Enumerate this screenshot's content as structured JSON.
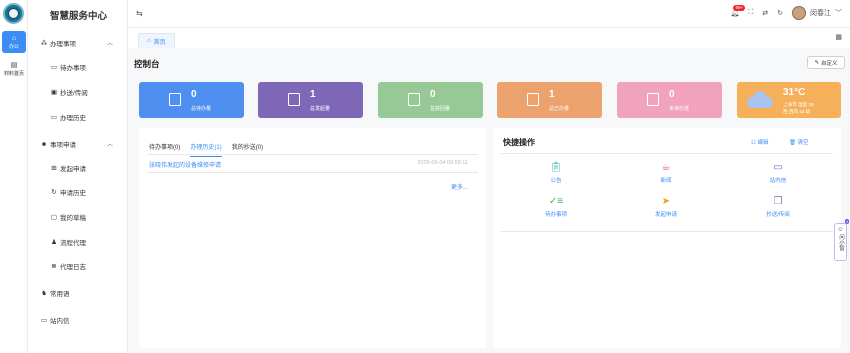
{
  "app_title": "智慧服务中心",
  "rail": [
    {
      "label": "办公",
      "icon": "home-icon",
      "active": true
    },
    {
      "label": "材料首页",
      "icon": "calendar-icon",
      "active": false
    }
  ],
  "sidebar": {
    "groups": [
      {
        "label": "办理事项",
        "icon": "apps-icon",
        "items": [
          {
            "label": "待办事项",
            "icon": "briefcase-icon"
          },
          {
            "label": "抄送/传阅",
            "icon": "inbox-icon"
          },
          {
            "label": "办理历史",
            "icon": "history-icon"
          }
        ]
      },
      {
        "label": "事项申请",
        "icon": "form-icon",
        "items": [
          {
            "label": "发起申请",
            "icon": "plus-square-icon"
          },
          {
            "label": "申请历史",
            "icon": "refresh-icon"
          },
          {
            "label": "我的草稿",
            "icon": "draft-icon"
          },
          {
            "label": "流程代理",
            "icon": "agent-icon"
          },
          {
            "label": "代理日志",
            "icon": "log-icon"
          }
        ]
      }
    ],
    "extra": [
      {
        "label": "常用语",
        "icon": "users-icon"
      },
      {
        "label": "站内信",
        "icon": "message-icon"
      }
    ]
  },
  "topbar": {
    "notification_badge": "99+",
    "username": "闵春江"
  },
  "tabs": [
    {
      "label": "首页"
    }
  ],
  "console": {
    "title": "控制台",
    "customize_label": "自定义",
    "stats": [
      {
        "value": "0",
        "label": "总待办量",
        "color": "#4f8ff0"
      },
      {
        "value": "1",
        "label": "总发起量",
        "color": "#7e67b7"
      },
      {
        "value": "0",
        "label": "总获回量",
        "color": "#97c996"
      },
      {
        "value": "1",
        "label": "总已办量",
        "color": "#eca26c"
      },
      {
        "value": "0",
        "label": "未读抄送",
        "color": "#f1a2bd"
      }
    ],
    "weather": {
      "temp": "31°C",
      "line1": "上海市  湿度 39",
      "line2": "西 西风 ≤3 级",
      "color": "#f7b05a"
    }
  },
  "left_panel": {
    "tabs": [
      {
        "label": "待办事项(0)",
        "active": false
      },
      {
        "label": "办理历史(1)",
        "active": true
      },
      {
        "label": "我的抄送(0)",
        "active": false
      }
    ],
    "rows": [
      {
        "title": "张晓伟发起的设备维修申请",
        "time": "2025-06-04 09:58:11"
      }
    ],
    "more_label": "更多..."
  },
  "quick_ops": {
    "title": "快捷操作",
    "edit_label": "编辑",
    "clear_label": "清空",
    "items": [
      {
        "label": "公告",
        "icon": "clipboard-icon",
        "color": "#36b3b3"
      },
      {
        "label": "新闻",
        "icon": "news-icon",
        "color": "#e0559a"
      },
      {
        "label": "站内信",
        "icon": "chat-icon",
        "color": "#8e5be5"
      },
      {
        "label": "待办事项",
        "icon": "checklist-icon",
        "color": "#4caf50"
      },
      {
        "label": "发起申请",
        "icon": "send-icon",
        "color": "#f0a020"
      },
      {
        "label": "抄送/传阅",
        "icon": "documents-icon",
        "color": "#7c8aa5"
      }
    ]
  },
  "assistant": {
    "label": "问小智",
    "badge": "4"
  }
}
